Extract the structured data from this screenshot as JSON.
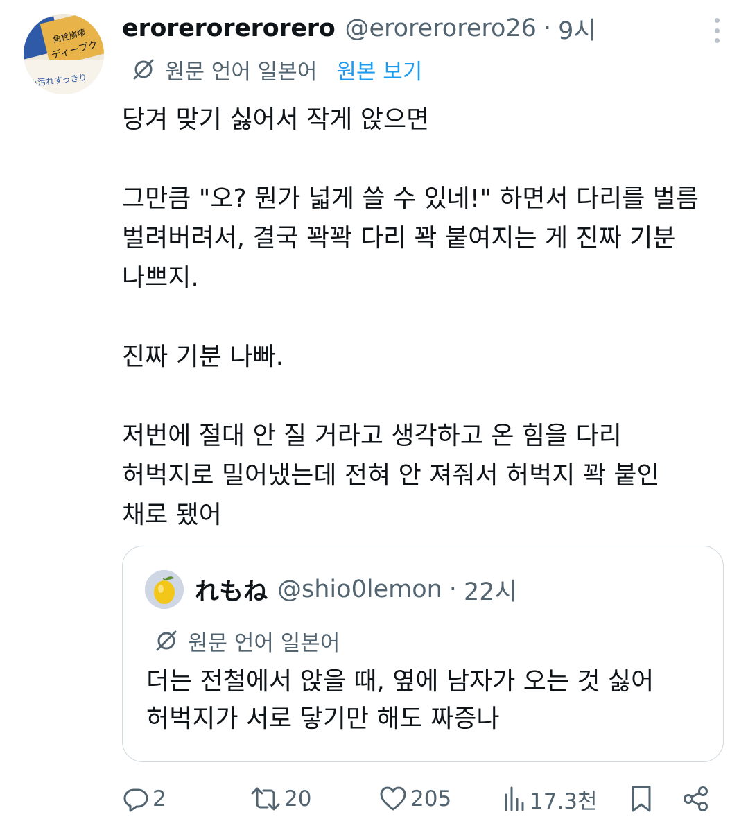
{
  "tweet": {
    "display_name": "erorerorerorero",
    "handle": "@erorerorero26",
    "separator": "·",
    "time": "9시",
    "translate": {
      "lang_label": "원문 언어 일본어",
      "view_original": "원본 보기"
    },
    "avatar_text": {
      "line1": "角栓崩壊",
      "line2": "ディープク",
      "line3": "み汚れすっきり"
    },
    "body": [
      "당겨 맞기 싫어서 작게 앉으면",
      "",
      "그만큼 \"오? 뭔가 넓게 쓸 수 있네!\" 하면서 다리를 벌름",
      "벌려버려서, 결국 꽉꽉 다리 꽉 붙여지는 게 진짜 기분",
      "나쁘지.",
      "",
      "진짜 기분 나빠.",
      "",
      "저번에 절대 안 질 거라고 생각하고 온 힘을 다리",
      "허벅지로 밀어냈는데 전혀 안 져줘서 허벅지 꽉 붙인",
      "채로 됐어"
    ]
  },
  "quote": {
    "display_name": "れもね",
    "handle": "@shio0lemon",
    "separator": "·",
    "time": "22시",
    "translate": {
      "lang_label": "원문 언어 일본어"
    },
    "body": [
      "더는 전철에서 앉을 때, 옆에 남자가 오는 것 싫어",
      "허벅지가 서로 닿기만 해도 짜증나"
    ]
  },
  "actions": {
    "replies": "2",
    "retweets": "20",
    "likes": "205",
    "views": "17.3천"
  },
  "colors": {
    "text": "#0f1419",
    "secondary": "#536471",
    "link": "#1d9bf0",
    "border": "#cfd9de"
  },
  "icons": [
    "more-icon",
    "translate-icon",
    "reply-icon",
    "retweet-icon",
    "like-icon",
    "views-icon",
    "bookmark-icon",
    "share-icon"
  ]
}
